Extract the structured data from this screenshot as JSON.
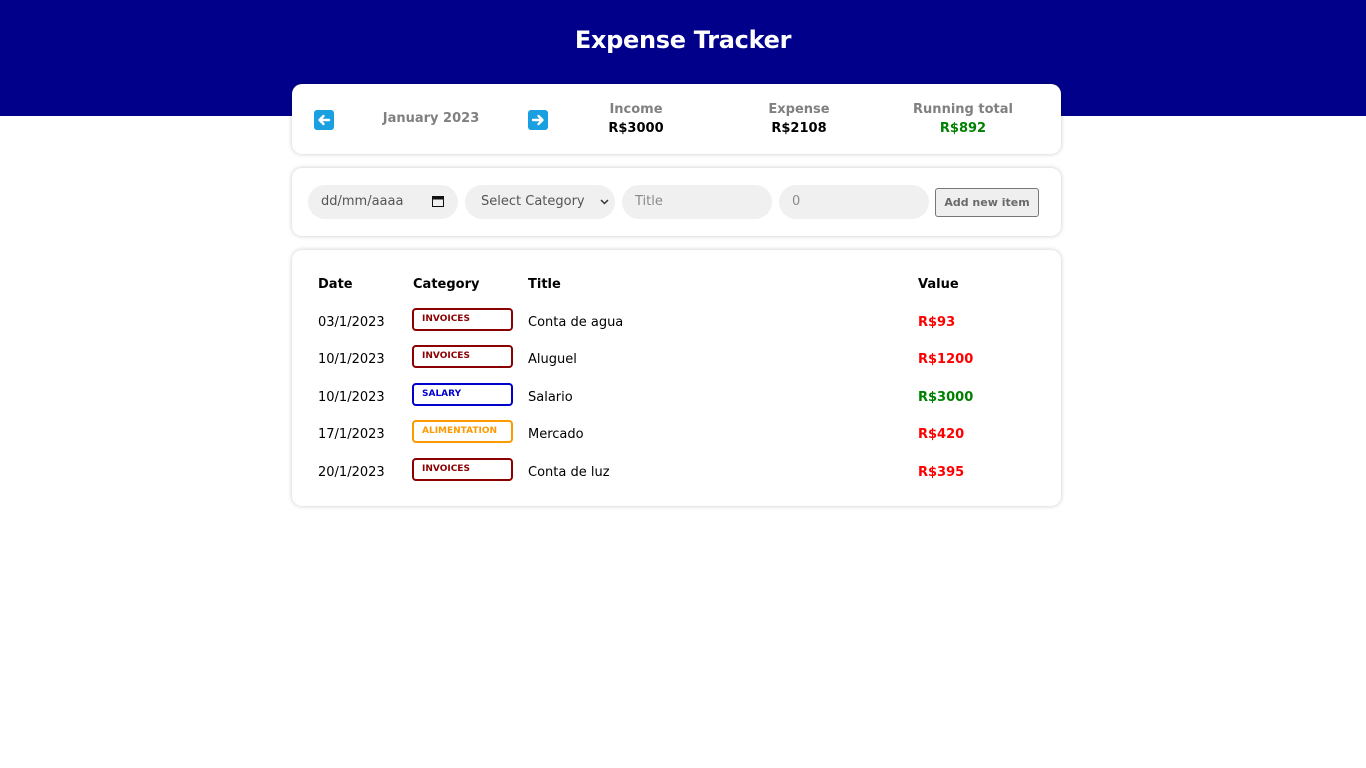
{
  "app": {
    "title": "Expense Tracker"
  },
  "summary": {
    "month": "January 2023",
    "prev_icon": "arrow-left-icon",
    "next_icon": "arrow-right-icon",
    "income_label": "Income",
    "income_value": "R$3000",
    "expense_label": "Expense",
    "expense_value": "R$2108",
    "total_label": "Running total",
    "total_value": "R$892",
    "total_color": "#008000"
  },
  "form": {
    "date_placeholder": "dd/mm/aaaa",
    "category_selected": "Select Category",
    "title_placeholder": "Title",
    "value_placeholder": "0",
    "add_button": "Add new item"
  },
  "table": {
    "headers": {
      "date": "Date",
      "category": "Category",
      "title": "Title",
      "value": "Value"
    },
    "rows": [
      {
        "date": "03/1/2023",
        "category": "INVOICES",
        "category_color": "#8b0000",
        "title": "Conta de agua",
        "value": "R$93",
        "value_color": "#ff0000"
      },
      {
        "date": "10/1/2023",
        "category": "INVOICES",
        "category_color": "#8b0000",
        "title": "Aluguel",
        "value": "R$1200",
        "value_color": "#ff0000"
      },
      {
        "date": "10/1/2023",
        "category": "SALARY",
        "category_color": "#0000cd",
        "title": "Salario",
        "value": "R$3000",
        "value_color": "#008000"
      },
      {
        "date": "17/1/2023",
        "category": "ALIMENTATION",
        "category_color": "#ff9900",
        "title": "Mercado",
        "value": "R$420",
        "value_color": "#ff0000"
      },
      {
        "date": "20/1/2023",
        "category": "INVOICES",
        "category_color": "#8b0000",
        "title": "Conta de luz",
        "value": "R$395",
        "value_color": "#ff0000"
      }
    ]
  },
  "colors": {
    "header_bg": "#00008b",
    "arrow_bg": "#1a9fe0"
  }
}
